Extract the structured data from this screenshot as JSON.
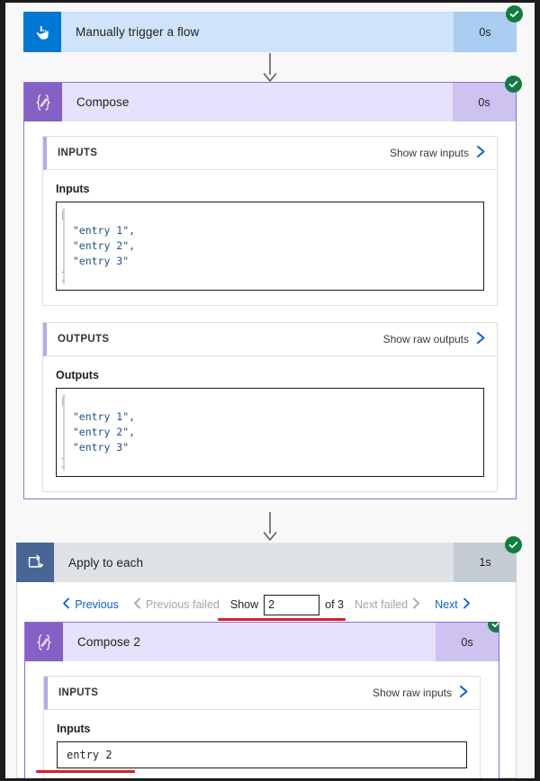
{
  "flow": {
    "trigger": {
      "title": "Manually trigger a flow",
      "duration": "0s",
      "icon": "hand-pointer-icon",
      "status": "succeeded",
      "accent": "#0078d4",
      "header_bg": "#cfe4fa"
    },
    "compose": {
      "title": "Compose",
      "duration": "0s",
      "icon": "compose-braces-icon",
      "status": "succeeded",
      "accent": "#8661c5",
      "header_bg": "#e8e1fb",
      "inputs_panel": {
        "header": "INPUTS",
        "raw_link": "Show raw inputs",
        "field_label": "Inputs",
        "code": "[\n  \"entry 1\",\n  \"entry 2\",\n  \"entry 3\"\n]"
      },
      "outputs_panel": {
        "header": "OUTPUTS",
        "raw_link": "Show raw outputs",
        "field_label": "Outputs",
        "code": "[\n  \"entry 1\",\n  \"entry 2\",\n  \"entry 3\"\n]"
      }
    },
    "apply_to_each": {
      "title": "Apply to each",
      "duration": "1s",
      "icon": "loop-repeat-icon",
      "status": "succeeded",
      "accent": "#486695",
      "header_bg": "#dfe3e8",
      "pagination": {
        "previous": "Previous",
        "previous_failed": "Previous failed",
        "show_label": "Show",
        "current_value": "2",
        "of_label": "of 3",
        "next_failed": "Next failed",
        "next": "Next"
      }
    },
    "compose2": {
      "title": "Compose 2",
      "duration": "0s",
      "icon": "compose-braces-icon",
      "status": "succeeded",
      "accent": "#8661c5",
      "header_bg": "#e8e1fb",
      "inputs_panel": {
        "header": "INPUTS",
        "raw_link": "Show raw inputs",
        "field_label": "Inputs",
        "value": "entry 2"
      }
    }
  },
  "colors": {
    "success_green": "#107c41",
    "link_blue": "#0b63ce",
    "annotation_red": "#d6202a",
    "canvas_bg": "#f8f8f8"
  }
}
